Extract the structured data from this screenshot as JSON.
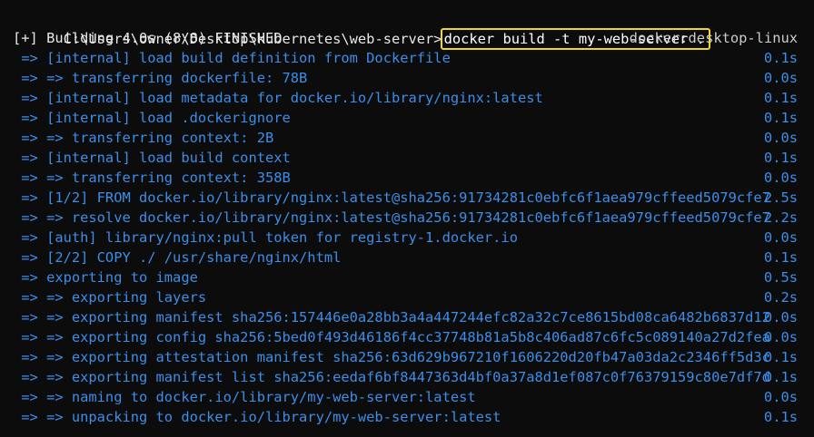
{
  "terminal": {
    "prompt": "C:\\Users\\owner\\Desktop\\kubernetes\\web-server>",
    "command": "docker build -t my-web-server .",
    "status_line": "[+] Building 4.0s (8/8) FINISHED",
    "builder": "docker:desktop-linux",
    "colors": {
      "background": "#0c0c0c",
      "step_text": "#3b8eea",
      "highlight_border": "#f2d61c"
    },
    "steps": [
      {
        "text": " => [internal] load build definition from Dockerfile",
        "time": "0.1s"
      },
      {
        "text": " => => transferring dockerfile: 78B",
        "time": "0.0s"
      },
      {
        "text": " => [internal] load metadata for docker.io/library/nginx:latest",
        "time": "0.1s"
      },
      {
        "text": " => [internal] load .dockerignore",
        "time": "0.1s"
      },
      {
        "text": " => => transferring context: 2B",
        "time": "0.0s"
      },
      {
        "text": " => [internal] load build context",
        "time": "0.1s"
      },
      {
        "text": " => => transferring context: 358B",
        "time": "0.0s"
      },
      {
        "text": " => [1/2] FROM docker.io/library/nginx:latest@sha256:91734281c0ebfc6f1aea979cffeed5079cfe7",
        "time": "2.5s"
      },
      {
        "text": " => => resolve docker.io/library/nginx:latest@sha256:91734281c0ebfc6f1aea979cffeed5079cfe7",
        "time": "2.2s"
      },
      {
        "text": " => [auth] library/nginx:pull token for registry-1.docker.io",
        "time": "0.0s"
      },
      {
        "text": " => [2/2] COPY ./ /usr/share/nginx/html",
        "time": "0.1s"
      },
      {
        "text": " => exporting to image",
        "time": "0.5s"
      },
      {
        "text": " => => exporting layers",
        "time": "0.2s"
      },
      {
        "text": " => => exporting manifest sha256:157446e0a28bb3a4a447244efc82a32c7ce8615bd08ca6482b6837d12",
        "time": "0.0s"
      },
      {
        "text": " => => exporting config sha256:5bed0f493d46186f4cc37748b81a5b8c406ad87c6fc5c089140a27d2fea",
        "time": "0.0s"
      },
      {
        "text": " => => exporting attestation manifest sha256:63d629b967210f1606220d20fb47a03da2c2346ff5d3c",
        "time": "0.1s"
      },
      {
        "text": " => => exporting manifest list sha256:eedaf6bf8447363d4bf0a37a8d1ef087c0f76379159c80e7df7d",
        "time": "0.1s"
      },
      {
        "text": " => => naming to docker.io/library/my-web-server:latest",
        "time": "0.0s"
      },
      {
        "text": " => => unpacking to docker.io/library/my-web-server:latest",
        "time": "0.1s"
      }
    ]
  }
}
